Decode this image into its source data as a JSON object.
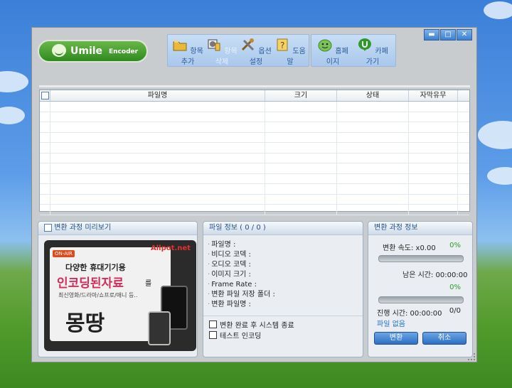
{
  "window": {
    "buttons": {
      "minimize": "▬",
      "maximize": "□",
      "close": "✕"
    }
  },
  "logo": {
    "name": "Umile",
    "suffix": "Encoder"
  },
  "toolbar": [
    {
      "id": "add-item",
      "label": "항목추가",
      "icon": "folder-add-icon"
    },
    {
      "id": "delete-item",
      "label": "항목삭제",
      "icon": "delete-icon"
    },
    {
      "id": "options",
      "label": "옵션설정",
      "icon": "tools-icon"
    },
    {
      "id": "help",
      "label": "도움말",
      "icon": "help-icon"
    },
    {
      "id": "homepage",
      "label": "홈페이지",
      "icon": "umile-face-icon"
    },
    {
      "id": "cafe",
      "label": "카페가기",
      "icon": "cafe-icon"
    }
  ],
  "file_list": {
    "columns": [
      "파일명",
      "크기",
      "상태",
      "자막유무"
    ],
    "rows": []
  },
  "preview_panel": {
    "title": "변환 과정 미리보기",
    "ad": {
      "brand": "Allpot.net",
      "badge": "ON-AIR",
      "line1": "다양한 휴대기기용",
      "line2": "인코딩된자료",
      "line2_suffix": "를",
      "line3": "최신영화/드라마/쇼프로/애니 등..",
      "line4": "몽땅"
    }
  },
  "file_info": {
    "title": "파일 정보 ( 0 / 0 )",
    "fields": [
      "파일명 :",
      "비디오 코덱 :",
      "오디오 코덱 :",
      "이미지 크기 :",
      "Frame Rate :",
      "변환 파일 저장 폴더 :",
      "변환 파일명 :"
    ],
    "options": [
      {
        "label": "변환 완료 후 시스템 종료",
        "checked": false
      },
      {
        "label": "테스트 인코딩",
        "checked": false
      }
    ]
  },
  "progress": {
    "title": "변환 과정 정보",
    "speed_label": "변환 속도: x0.00",
    "speed_pct": "0%",
    "speed_fraction": 0,
    "remaining": "남은 시간: 00:00:00",
    "total_pct": "0%",
    "total_fraction": 0,
    "elapsed": "진행 시간: 00:00:00",
    "count": "0/0",
    "status": "파일 없음",
    "convert_button": "변환",
    "cancel_button": "취소"
  }
}
